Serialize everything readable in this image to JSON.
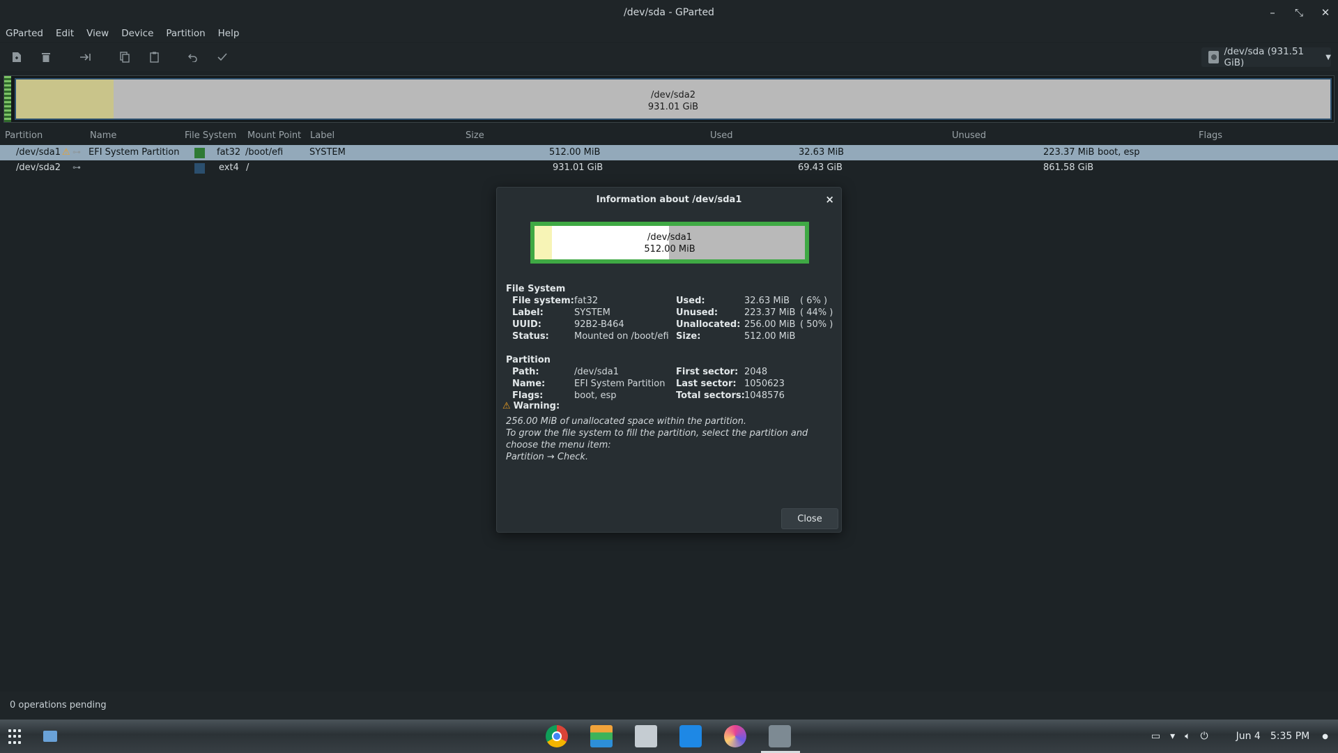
{
  "window": {
    "title": "/dev/sda - GParted"
  },
  "menu": [
    "GParted",
    "Edit",
    "View",
    "Device",
    "Partition",
    "Help"
  ],
  "device_selector": {
    "label": "/dev/sda (931.51 GiB)"
  },
  "disk_map": {
    "partition": "/dev/sda2",
    "size": "931.01 GiB"
  },
  "table": {
    "headers": [
      "Partition",
      "Name",
      "File System",
      "Mount Point",
      "Label",
      "Size",
      "Used",
      "Unused",
      "Flags"
    ],
    "rows": [
      {
        "partition": "/dev/sda1",
        "name": "EFI System Partition",
        "fs": "fat32",
        "fs_color": "#2f7a34",
        "mount": "/boot/efi",
        "label": "SYSTEM",
        "size": "512.00 MiB",
        "used": "32.63 MiB",
        "unused": "223.37 MiB",
        "flags": "boot, esp"
      },
      {
        "partition": "/dev/sda2",
        "name": "",
        "fs": "ext4",
        "fs_color": "#2b4f6e",
        "mount": "/",
        "label": "",
        "size": "931.01 GiB",
        "used": "69.43 GiB",
        "unused": "861.58 GiB",
        "flags": ""
      }
    ]
  },
  "dialog": {
    "title": "Information about /dev/sda1",
    "map": {
      "partition": "/dev/sda1",
      "size": "512.00 MiB"
    },
    "fs_section": "File System",
    "fs": {
      "filesystem_k": "File system:",
      "filesystem_v": "fat32",
      "label_k": "Label:",
      "label_v": "SYSTEM",
      "uuid_k": "UUID:",
      "uuid_v": "92B2-B464",
      "status_k": "Status:",
      "status_v": "Mounted on /boot/efi",
      "used_k": "Used:",
      "used_v": "32.63 MiB",
      "used_pct": "( 6% )",
      "unused_k": "Unused:",
      "unused_v": "223.37 MiB",
      "unused_pct": "( 44% )",
      "unalloc_k": "Unallocated:",
      "unalloc_v": "256.00 MiB",
      "unalloc_pct": "( 50% )",
      "size_k": "Size:",
      "size_v": "512.00 MiB"
    },
    "part_section": "Partition",
    "part": {
      "path_k": "Path:",
      "path_v": "/dev/sda1",
      "name_k": "Name:",
      "name_v": "EFI System Partition",
      "flags_k": "Flags:",
      "flags_v": "boot, esp",
      "first_k": "First sector:",
      "first_v": "2048",
      "last_k": "Last sector:",
      "last_v": "1050623",
      "total_k": "Total sectors:",
      "total_v": "1048576"
    },
    "warning_title": "Warning:",
    "warning_lines": [
      "256.00 MiB of unallocated space within the partition.",
      "To grow the file system to fill the partition, select the partition and",
      "choose the menu item:",
      "Partition → Check."
    ],
    "close_label": "Close"
  },
  "status": {
    "text": "0 operations pending"
  },
  "taskbar": {
    "date": "Jun 4",
    "time": "5:35 PM"
  }
}
